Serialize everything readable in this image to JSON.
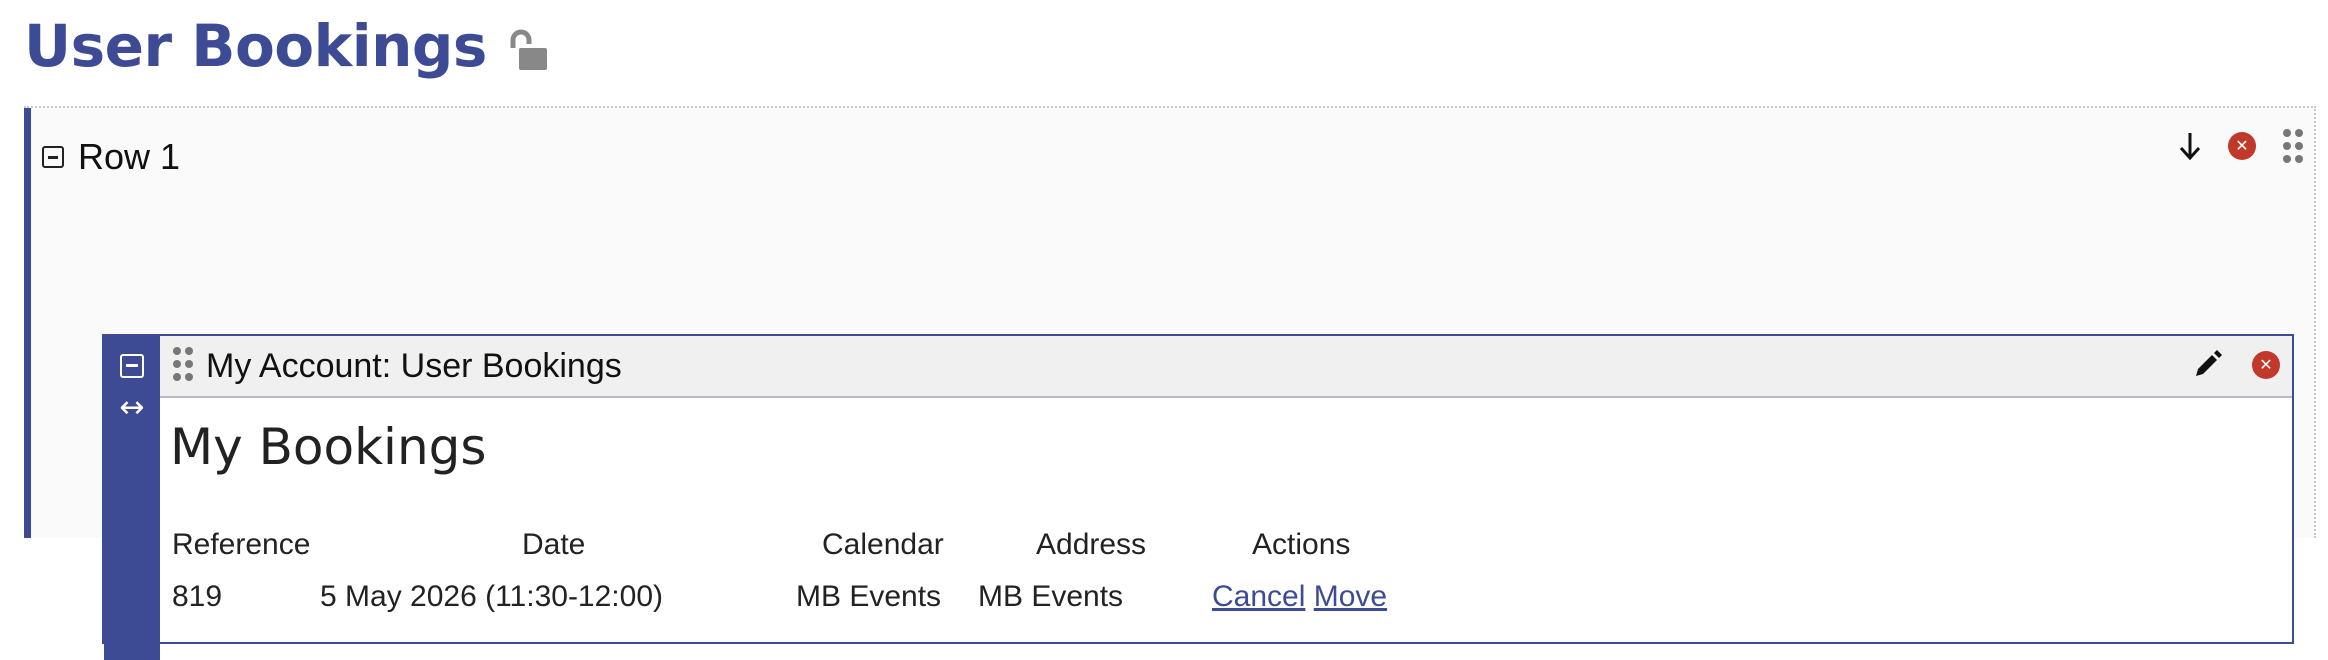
{
  "page": {
    "title": "User Bookings",
    "lock_icon": "unlocked-padlock-icon"
  },
  "row": {
    "title": "Row 1",
    "collapse_icon": "collapse-square-icon",
    "tools": {
      "move_down_icon": "arrow-down-icon",
      "remove_icon": "close-circle-icon",
      "drag_icon": "drag-handle-icon"
    }
  },
  "module": {
    "title": "My Account: User Bookings",
    "side_icons": [
      "collapse-square-icon",
      "resize-horizontal-icon"
    ],
    "tools": {
      "edit_icon": "pencil-icon",
      "remove_icon": "close-circle-icon"
    }
  },
  "content": {
    "heading": "My Bookings",
    "columns": [
      "Reference",
      "Date",
      "Calendar",
      "Address",
      "Actions"
    ],
    "rows": [
      {
        "reference": "819",
        "date": "5 May 2026 (11:30-12:00)",
        "calendar": "MB Events",
        "address": "MB Events",
        "actions": [
          "Cancel",
          "Move"
        ]
      }
    ]
  },
  "colors": {
    "accent": "#3d4a94",
    "danger": "#c0392b",
    "panel_bg": "#fafafa"
  }
}
